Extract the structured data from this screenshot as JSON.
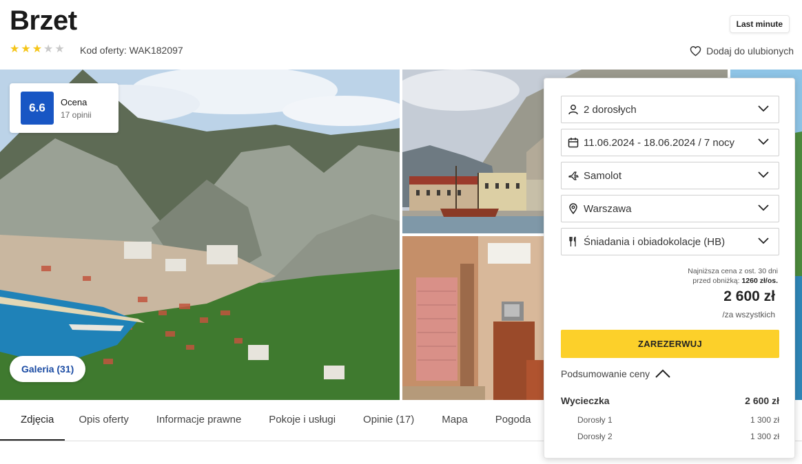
{
  "hotel": {
    "name": "Brzet",
    "stars": 3,
    "stars_max": 5,
    "offer_code": "Kod oferty: WAK182097",
    "tag": "Last minute",
    "favorite_label": "Dodaj do ulubionych"
  },
  "rating": {
    "score": "6.6",
    "label": "Ocena",
    "reviews": "17 opinii"
  },
  "gallery": {
    "button": "Galeria (31)"
  },
  "tabs": [
    {
      "label": "Zdjęcia",
      "active": true
    },
    {
      "label": "Opis oferty"
    },
    {
      "label": "Informacje prawne"
    },
    {
      "label": "Pokoje i usługi"
    },
    {
      "label": "Opinie (17)"
    },
    {
      "label": "Mapa"
    },
    {
      "label": "Pogoda"
    }
  ],
  "booking": {
    "travelers": "2 dorosłych",
    "dates": "11.06.2024 - 18.06.2024 / 7 nocy",
    "transport": "Samolot",
    "departure": "Warszawa",
    "board": "Śniadania i obiadokolacje (HB)",
    "lowest_price_line1": "Najniższa cena z ost. 30 dni",
    "lowest_price_line2": "przed obniżką:",
    "lowest_price_value": "1260 zł/os.",
    "price": "2 600 zł",
    "price_note": "/za wszystkich",
    "book_button": "ZAREZERWUJ",
    "summary_label": "Podsumowanie ceny",
    "trip_label": "Wycieczka",
    "trip_total": "2 600 zł",
    "persons": [
      {
        "label": "Dorosły 1",
        "price": "1 300 zł"
      },
      {
        "label": "Dorosły 2",
        "price": "1 300 zł"
      }
    ]
  },
  "colors": {
    "accent_blue": "#1856c4",
    "book_yellow": "#fcd02a",
    "star_on": "#f5c518"
  }
}
